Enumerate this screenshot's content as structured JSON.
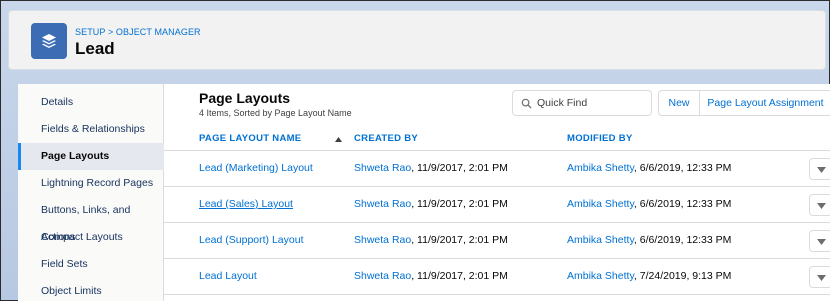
{
  "header": {
    "breadcrumb": "SETUP > OBJECT MANAGER",
    "title": "Lead",
    "icon": "layers-icon",
    "icon_color": "#3c6db4"
  },
  "sidebar": {
    "items": [
      {
        "label": "Details"
      },
      {
        "label": "Fields & Relationships"
      },
      {
        "label": "Page Layouts",
        "active": true
      },
      {
        "label": "Lightning Record Pages"
      },
      {
        "label": "Buttons, Links, and Actions"
      },
      {
        "label": "Compact Layouts"
      },
      {
        "label": "Field Sets"
      },
      {
        "label": "Object Limits"
      }
    ]
  },
  "main": {
    "title": "Page Layouts",
    "subtitle": "4 Items, Sorted by Page Layout Name",
    "search": {
      "placeholder": "Quick Find",
      "value": ""
    },
    "new_button": "New",
    "assignment_button": "Page Layout Assignment",
    "columns": [
      "PAGE LAYOUT NAME",
      "CREATED BY",
      "MODIFIED BY"
    ],
    "rows": [
      {
        "name": "Lead (Marketing) Layout",
        "created_by": "Shweta Rao",
        "created_at": ", 11/9/2017, 2:01 PM",
        "modified_by": "Ambika Shetty",
        "modified_at": ", 6/6/2019, 12:33 PM"
      },
      {
        "name": "Lead (Sales) Layout",
        "created_by": "Shweta Rao",
        "created_at": ", 11/9/2017, 2:01 PM",
        "modified_by": "Ambika Shetty",
        "modified_at": ", 6/6/2019, 12:33 PM"
      },
      {
        "name": "Lead (Support) Layout",
        "created_by": "Shweta Rao",
        "created_at": ", 11/9/2017, 2:01 PM",
        "modified_by": "Ambika Shetty",
        "modified_at": ", 6/6/2019, 12:33 PM"
      },
      {
        "name": "Lead Layout",
        "created_by": "Shweta Rao",
        "created_at": ", 11/9/2017, 2:01 PM",
        "modified_by": "Ambika Shetty",
        "modified_at": ", 7/24/2019, 9:13 PM"
      }
    ]
  },
  "colors": {
    "link": "#0070d2",
    "active_indicator": "#1589ee",
    "banner": "#b7c8e2"
  }
}
